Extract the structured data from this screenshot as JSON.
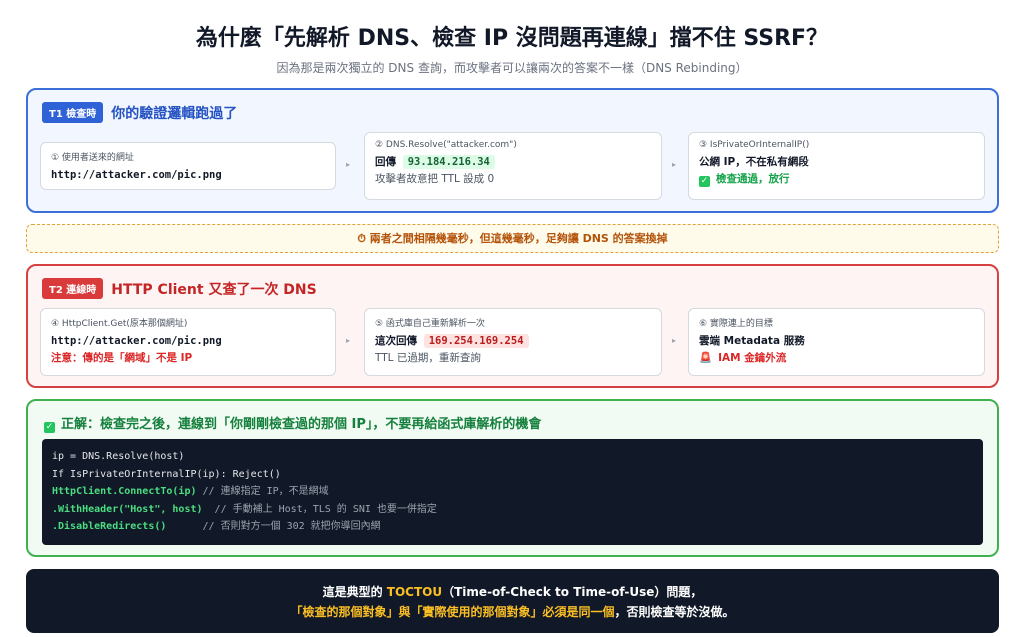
{
  "title": "為什麼「先解析 DNS、檢查 IP 沒問題再連線」擋不住 SSRF？",
  "subtitle": "因為那是兩次獨立的 DNS 查詢，而攻擊者可以讓兩次的答案不一樣（DNS Rebinding）",
  "t1": {
    "tag": "T1  檢查時",
    "heading": "你的驗證邏輯跑過了",
    "step1": {
      "label": "① 使用者送來的網址",
      "url": "http://attacker.com/pic.png"
    },
    "step2": {
      "label": "② DNS.Resolve(\"attacker.com\")",
      "return_label": "回傳",
      "ip": "93.184.216.34",
      "note": "攻擊者故意把 TTL 設成 0"
    },
    "step3": {
      "label": "③ IsPrivateOrInternalIP()",
      "line": "公網 IP，不在私有網段",
      "result": "檢查通過，放行"
    }
  },
  "gap_note": "⏱ 兩者之間相隔幾毫秒，但這幾毫秒，足夠讓 DNS 的答案換掉",
  "t2": {
    "tag": "T2  連線時",
    "heading": "HTTP Client 又查了一次 DNS",
    "step4": {
      "label": "④ HttpClient.Get(原本那個網址)",
      "url": "http://attacker.com/pic.png",
      "note": "注意：傳的是「網域」不是 IP"
    },
    "step5": {
      "label": "⑤ 函式庫自己重新解析一次",
      "return_label": "這次回傳",
      "ip": "169.254.169.254",
      "note": "TTL 已過期，重新查詢"
    },
    "step6": {
      "label": "⑥ 實際連上的目標",
      "line": "雲端 Metadata 服務",
      "result": "IAM 金鑰外流"
    }
  },
  "fix": {
    "heading": "正解：檢查完之後，連線到「你剛剛檢查過的那個 IP」，不要再給函式庫解析的機會",
    "code": [
      {
        "text": "ip = DNS.Resolve(host)",
        "comment": ""
      },
      {
        "text": "If IsPrivateOrInternalIP(ip): Reject()",
        "comment": ""
      },
      {
        "text": "HttpClient.ConnectTo(ip)",
        "comment": " // 連線指定 IP，不是網域"
      },
      {
        "text": ".WithHeader(\"Host\", host)",
        "comment": "  // 手動補上 Host，TLS 的 SNI 也要一併指定"
      },
      {
        "text": ".DisableRedirects()",
        "comment": "      // 否則對方一個 302 就把你導回內網"
      }
    ]
  },
  "bottom": {
    "l1_a": "這是典型的 ",
    "l1_b": "TOCTOU",
    "l1_c": "（Time-of-Check to Time-of-Use）問題，",
    "l2_a": "「檢查的那個對象」與「實際使用的那個對象」必須是同一個",
    "l2_b": "，否則檢查等於沒做。"
  },
  "colors": {
    "blue": "#3b6fd9",
    "red": "#d64040",
    "green": "#3fb24f",
    "amber": "#e0a23a",
    "dark": "#111827"
  }
}
